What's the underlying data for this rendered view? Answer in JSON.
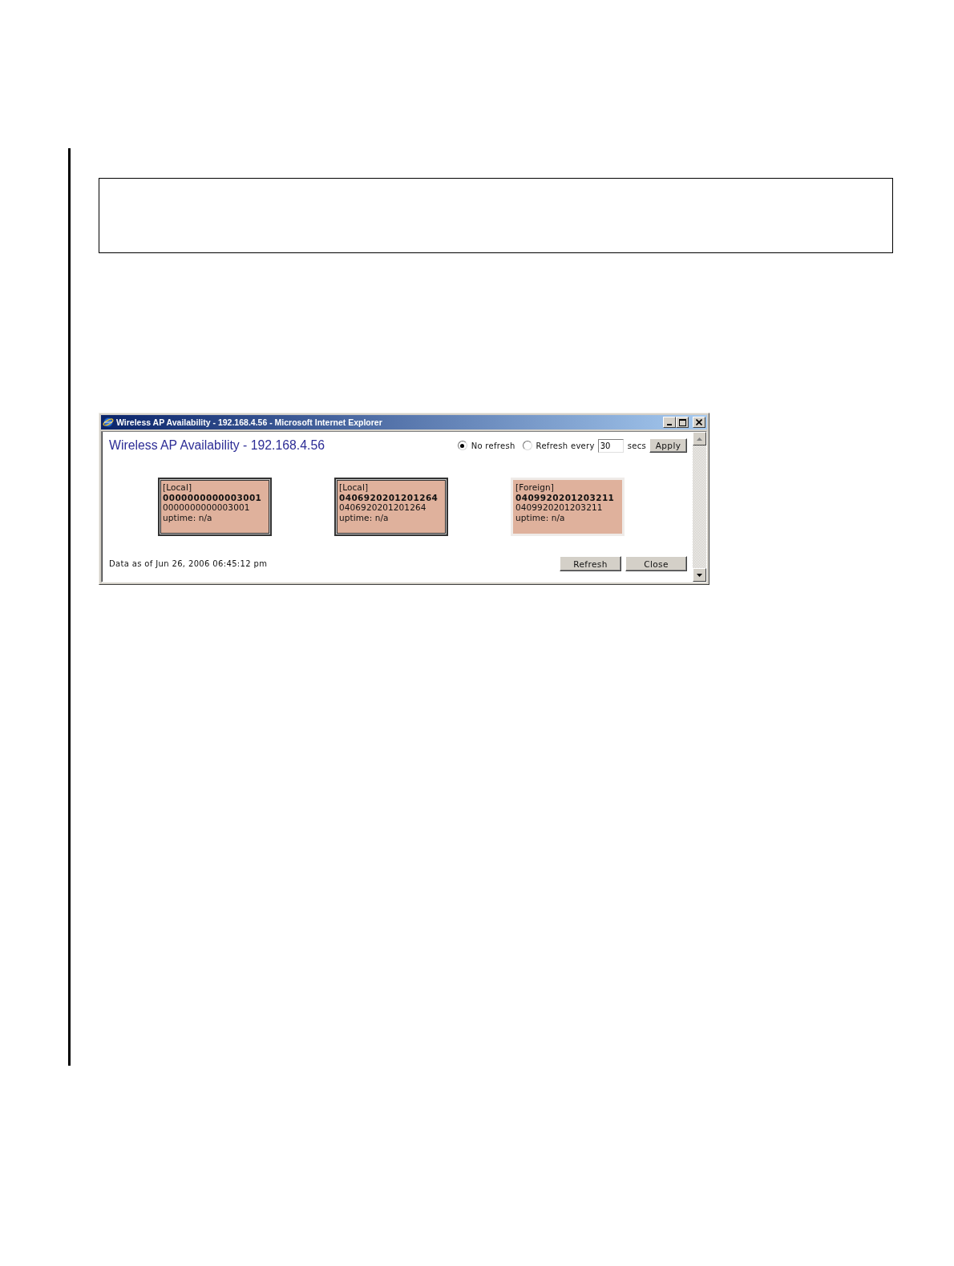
{
  "window": {
    "title": "Wireless AP Availability - 192.168.4.56 - Microsoft Internet Explorer"
  },
  "page": {
    "heading": "Wireless AP Availability - 192.168.4.56",
    "refresh_options": [
      {
        "label": "No refresh",
        "selected": true
      },
      {
        "label": "Refresh every",
        "selected": false
      }
    ],
    "interval": {
      "value": "30",
      "unit": "secs"
    },
    "apply_button": "Apply",
    "access_points": [
      {
        "kind": "local",
        "type_label": "[Local]",
        "name": "0000000000003001",
        "serial": "0000000000003001",
        "uptime": "uptime: n/a"
      },
      {
        "kind": "local",
        "type_label": "[Local]",
        "name": "0406920201201264",
        "serial": "0406920201201264",
        "uptime": "uptime: n/a"
      },
      {
        "kind": "foreign",
        "type_label": "[Foreign]",
        "name": "0409920201203211",
        "serial": "0409920201203211",
        "uptime": "uptime: n/a"
      }
    ],
    "footer": {
      "timestamp": "Data as of Jun 26, 2006 06:45:12 pm",
      "buttons": [
        "Refresh",
        "Close"
      ]
    }
  }
}
